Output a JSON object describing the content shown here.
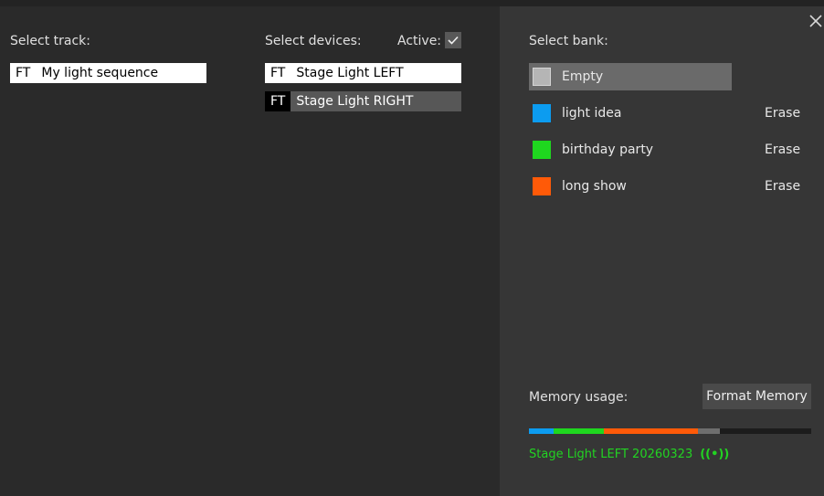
{
  "left": {
    "select_track_label": "Select track:",
    "select_devices_label": "Select devices:",
    "active_label": "Active:",
    "active_checked": true,
    "tracks": [
      {
        "badge": "FT",
        "name": "My light sequence",
        "selected": true
      }
    ],
    "devices": [
      {
        "badge": "FT",
        "name": "Stage Light LEFT",
        "selected": true
      },
      {
        "badge": "FT",
        "name": "Stage Light RIGHT",
        "selected": false
      }
    ]
  },
  "right": {
    "close_icon": "close-icon",
    "select_bank_label": "Select bank:",
    "banks": [
      {
        "name": "Empty",
        "color": "#b5b5b5",
        "selected": true,
        "erase": ""
      },
      {
        "name": "light idea",
        "color": "#0c9cf0",
        "selected": false,
        "erase": "Erase"
      },
      {
        "name": "birthday party",
        "color": "#1fd71f",
        "selected": false,
        "erase": "Erase"
      },
      {
        "name": "long show",
        "color": "#ff5a08",
        "selected": false,
        "erase": "Erase"
      }
    ],
    "memory_usage_label": "Memory usage:",
    "format_memory_label": "Format Memory",
    "memory_segments": [
      {
        "color": "#0c9cf0",
        "fraction": 0.088
      },
      {
        "color": "#1fd71f",
        "fraction": 0.178
      },
      {
        "color": "#ff5a08",
        "fraction": 0.334
      },
      {
        "color": "#6e6e6e",
        "fraction": 0.078
      }
    ],
    "status_text": "Stage Light LEFT 20260323",
    "status_icon": "broadcast-icon",
    "status_icon_glyph": "((•))",
    "status_color": "#22d322"
  }
}
